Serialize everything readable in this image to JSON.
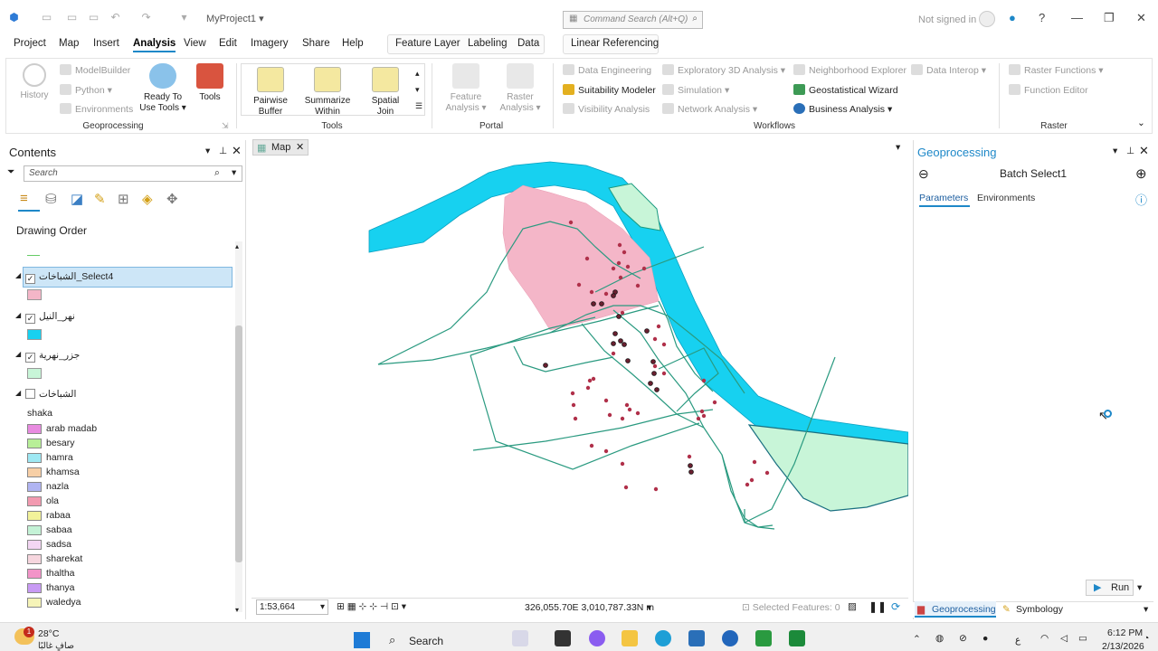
{
  "window": {
    "project_title": "MyProject1",
    "not_signed_in": "Not signed in",
    "help": "?"
  },
  "command_search": {
    "placeholder": "Command Search (Alt+Q)"
  },
  "menu": {
    "items": [
      "Project",
      "Map",
      "Insert",
      "Analysis",
      "View",
      "Edit",
      "Imagery",
      "Share",
      "Help"
    ],
    "active": "Analysis",
    "context_tabs": [
      "Feature Layer",
      "Labeling",
      "Data"
    ],
    "context_tab2": "Linear Referencing"
  },
  "ribbon": {
    "geoprocessing": {
      "label": "Geoprocessing",
      "history": "History",
      "modelbuilder": "ModelBuilder",
      "python": "Python",
      "environments": "Environments",
      "ready_to_use_1": "Ready To",
      "ready_to_use_2": "Use Tools",
      "tools": "Tools"
    },
    "tools": {
      "label": "Tools",
      "items": [
        {
          "l1": "Pairwise",
          "l2": "Buffer"
        },
        {
          "l1": "Summarize",
          "l2": "Within"
        },
        {
          "l1": "Spatial",
          "l2": "Join"
        }
      ]
    },
    "portal": {
      "label": "Portal",
      "feature_1": "Feature",
      "feature_2": "Analysis",
      "raster_1": "Raster",
      "raster_2": "Analysis"
    },
    "workflows": {
      "label": "Workflows",
      "data_engineering": "Data Engineering",
      "suitability": "Suitability Modeler",
      "visibility": "Visibility Analysis",
      "exploratory": "Exploratory 3D Analysis",
      "simulation": "Simulation",
      "network": "Network Analysis",
      "neighborhood": "Neighborhood Explorer",
      "geostat": "Geostatistical Wizard",
      "business": "Business Analysis",
      "data_interop": "Data Interop"
    },
    "raster": {
      "label": "Raster",
      "raster_functions": "Raster Functions",
      "function_editor": "Function Editor"
    }
  },
  "contents": {
    "title": "Contents",
    "search_placeholder": "Search",
    "drawing_order": "Drawing Order",
    "layers": [
      {
        "name": "الشباخات_Select4",
        "checked": true,
        "color": "#f4b6c8"
      },
      {
        "name": "نهر_النيل",
        "checked": true,
        "color": "#17d1f0"
      },
      {
        "name": "جزر_نهرية",
        "checked": true,
        "color": "#c8f5d8"
      },
      {
        "name": "الشباخات",
        "checked": false
      }
    ],
    "legend_field": "shaka",
    "legend": [
      {
        "label": "arab madab",
        "color": "#e88be0"
      },
      {
        "label": "besary",
        "color": "#b8ef98"
      },
      {
        "label": "hamra",
        "color": "#9ee8f3"
      },
      {
        "label": "khamsa",
        "color": "#f7cfa6"
      },
      {
        "label": "nazla",
        "color": "#b0b4f2"
      },
      {
        "label": "ola",
        "color": "#f29ab0"
      },
      {
        "label": "rabaa",
        "color": "#f2f29a"
      },
      {
        "label": "sabaa",
        "color": "#c4f2d6"
      },
      {
        "label": "sadsa",
        "color": "#f3d6f3"
      },
      {
        "label": "sharekat",
        "color": "#f6d6de"
      },
      {
        "label": "thaltha",
        "color": "#f294c8"
      },
      {
        "label": "thanya",
        "color": "#c89af4"
      },
      {
        "label": "waledya",
        "color": "#f6f4b8"
      }
    ]
  },
  "map": {
    "tab": "Map",
    "scale": "1:53,664",
    "coords": "326,055.70E 3,010,787.33N m",
    "selected_features": "Selected Features: 0"
  },
  "geoprocessing_pane": {
    "title": "Geoprocessing",
    "tool": "Batch Select1",
    "tab_parameters": "Parameters",
    "tab_environments": "Environments",
    "run": "Run",
    "bottom_tab1": "Geoprocessing",
    "bottom_tab2": "Symbology"
  },
  "taskbar": {
    "weather_temp": "28°C",
    "weather_desc": "صافٍ غالبًا",
    "weather_badge": "1",
    "search": "Search",
    "time": "6:12 PM",
    "date": "2/13/2026",
    "lang": "ع"
  }
}
